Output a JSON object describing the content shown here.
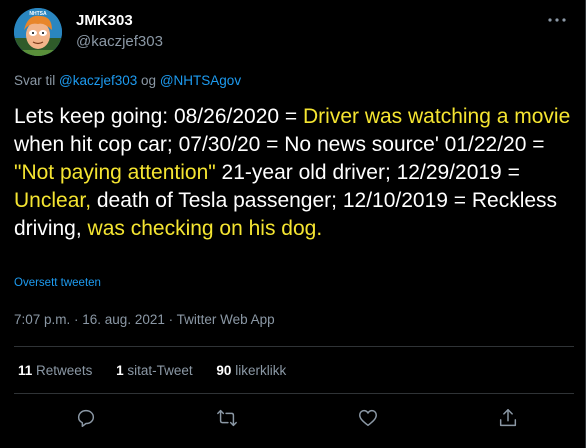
{
  "author": {
    "name": "JMK303",
    "handle": "@kaczjef303",
    "avatar_text": "NHTSA"
  },
  "reply_to": {
    "prefix": "Svar til",
    "mention_1": "@kaczjef303",
    "conjunction": "og",
    "mention_2": "@NHTSAgov"
  },
  "tweet": {
    "segments": [
      {
        "text": "Lets keep going: 08/26/2020 = ",
        "highlight": false
      },
      {
        "text": "Driver was watching a movie",
        "highlight": true
      },
      {
        "text": " when hit cop car; 07/30/20 = No news source' 01/22/20 = ",
        "highlight": false
      },
      {
        "text": "\"Not paying attention\"",
        "highlight": true
      },
      {
        "text": " 21-year old driver; 12/29/2019 = ",
        "highlight": false
      },
      {
        "text": "Unclear,",
        "highlight": true
      },
      {
        "text": " death of Tesla passenger; 12/10/2019 = Reckless driving, ",
        "highlight": false
      },
      {
        "text": "was checking on his dog.",
        "highlight": true
      }
    ],
    "translate_label": "Oversett tweeten",
    "timestamp": "7:07 p.m. · 16. aug. 2021 · Twitter Web App"
  },
  "stats": {
    "retweets_count": "11",
    "retweets_label": "Retweets",
    "quotes_count": "1",
    "quotes_label": "sitat-Tweet",
    "likes_count": "90",
    "likes_label": "likerklikk"
  },
  "icons": {
    "reply": "comment-icon",
    "retweet": "retweet-icon",
    "like": "heart-icon",
    "share": "share-icon",
    "more": "more-dots-icon"
  },
  "colors": {
    "background": "#000000",
    "text": "#ffffff",
    "secondary": "#8b98a5",
    "link": "#1d9bf0",
    "highlight": "#f5e531"
  }
}
